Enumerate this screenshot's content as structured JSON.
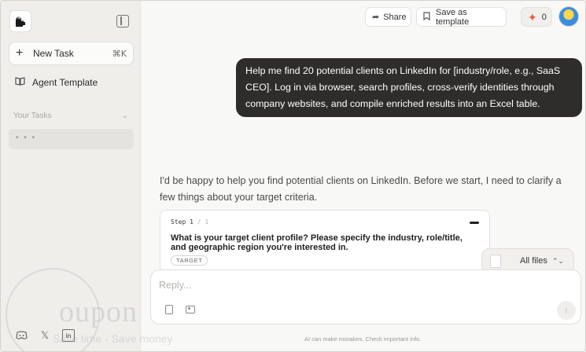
{
  "sidebar": {
    "new_task_label": "New Task",
    "new_task_shortcut": "⌘K",
    "agent_template_label": "Agent Template",
    "your_tasks_label": "Your Tasks",
    "task_placeholder": "• • •"
  },
  "header": {
    "share_label": "Share",
    "save_template_label": "Save as template",
    "credits": "0"
  },
  "chat": {
    "user_message": "Help me find 20 potential clients on LinkedIn for [industry/role, e.g., SaaS CEO]. Log in via browser, search profiles, cross-verify identities through company websites, and compile enriched results into an Excel table.",
    "assistant_message": "I'd be happy to help you find potential clients on LinkedIn. Before we start, I need to clarify a few things about your target criteria.",
    "step": {
      "label": "Step 1",
      "of": "/ 1",
      "question": "What is your target client profile? Please specify the industry, role/title, and geographic region you're interested in.",
      "tag": "TARGET"
    },
    "files_label": "All files"
  },
  "input": {
    "placeholder": "Reply..."
  },
  "disclaimer": "AI can make mistakes. Check important info.",
  "watermark": {
    "brand": "oupon",
    "tagline": "Save time - Save money"
  },
  "colors": {
    "accent": "#e8593d",
    "bubble": "#2e2d2b",
    "sidebar": "#efeeeb"
  }
}
